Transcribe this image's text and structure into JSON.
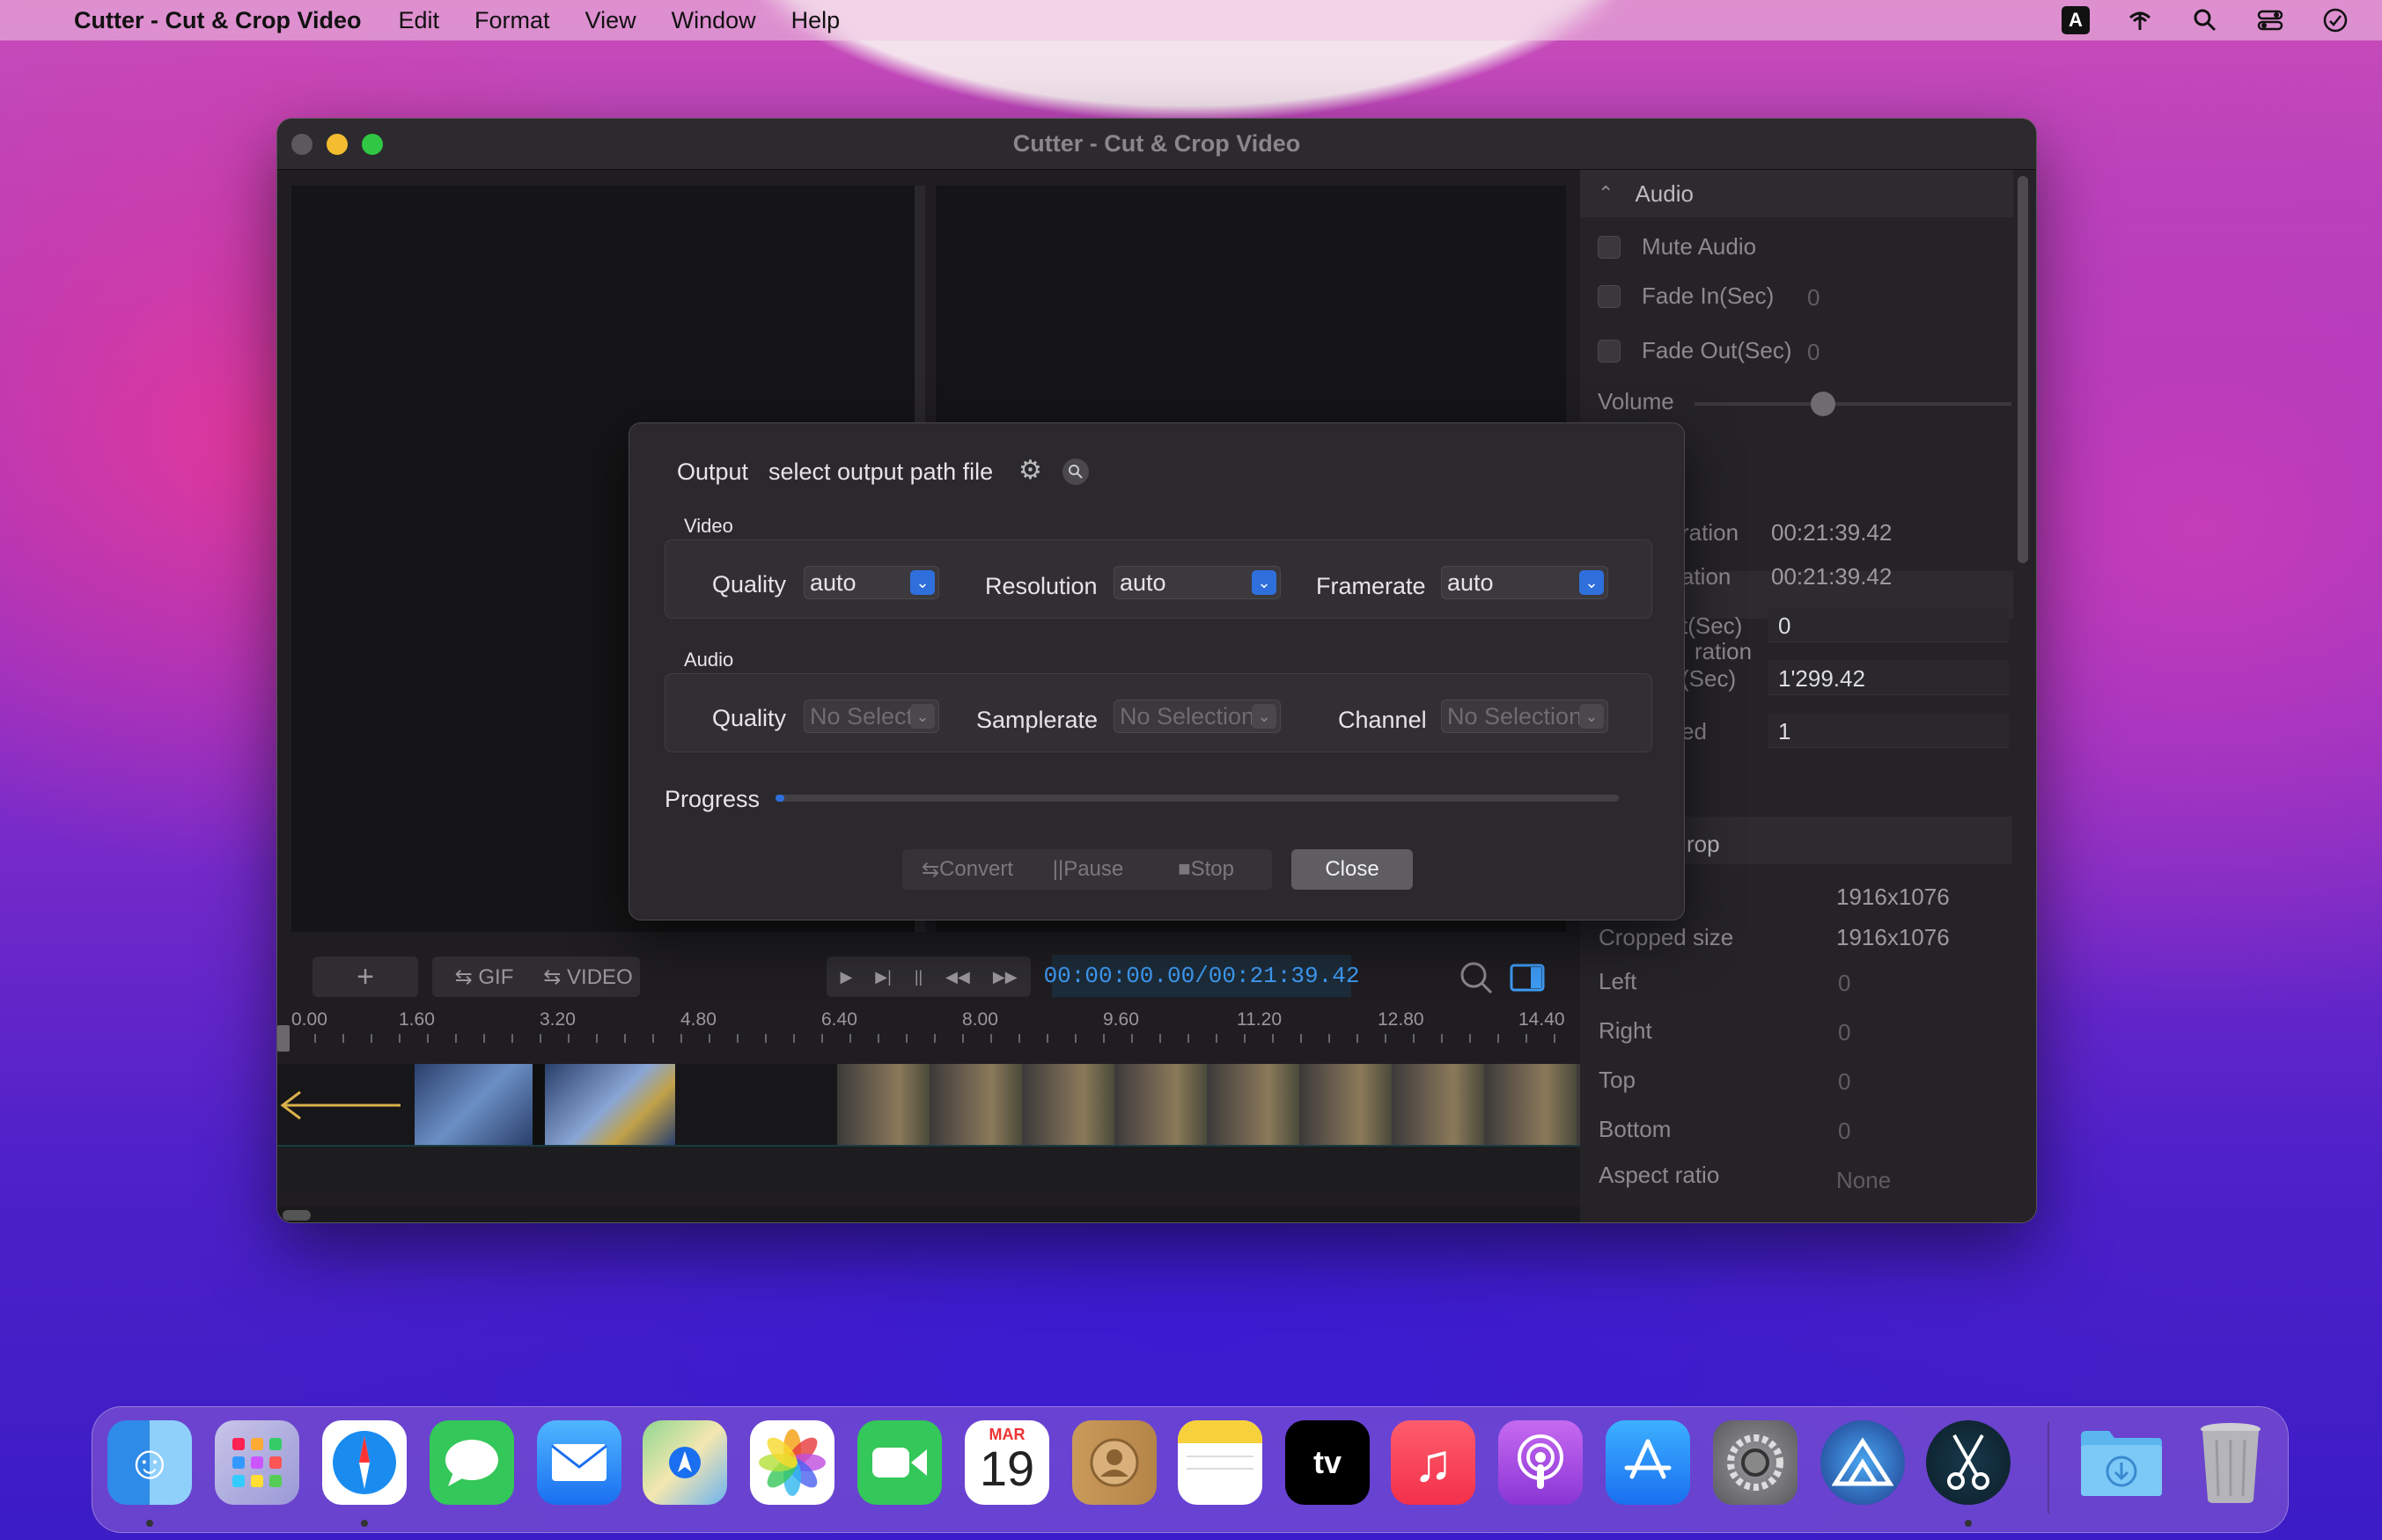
{
  "menubar": {
    "apple": "",
    "app_name": "Cutter - Cut & Crop Video",
    "items": [
      "Edit",
      "Format",
      "View",
      "Window",
      "Help"
    ],
    "keyboard_indicator": "A"
  },
  "window": {
    "title": "Cutter - Cut & Crop Video"
  },
  "toolbar": {
    "add": "+",
    "gif": "GIF",
    "video": "VIDEO",
    "timecode": "00:00:00.00/00:21:39.42"
  },
  "ruler": {
    "labels": [
      "0.00",
      "1.60",
      "3.20",
      "4.80",
      "6.40",
      "8.00",
      "9.60",
      "11.20",
      "12.80",
      "14.40"
    ]
  },
  "right_panel": {
    "audio_header": "Audio",
    "mute_audio": "Mute Audio",
    "fade_in": "Fade In(Sec)",
    "fade_in_value": "0",
    "fade_out": "Fade Out(Sec)",
    "fade_out_value": "0",
    "volume": "Volume",
    "volume_level": 0.4,
    "duration_label": "ration",
    "duration_value": "00:21:39.42",
    "duration2_label": "ation",
    "duration2_value": "00:21:39.42",
    "start_label": "t(Sec)",
    "start_value": "0",
    "end_label": "(Sec)",
    "end_value": "1'299.42",
    "speed_label": "ed",
    "speed_value": "1",
    "crop_header": "rop",
    "size_value": "1916x1076",
    "cropped_size_label": "Cropped size",
    "cropped_size_value": "1916x1076",
    "left": "Left",
    "left_value": "0",
    "right": "Right",
    "right_value": "0",
    "top": "Top",
    "top_value": "0",
    "bottom": "Bottom",
    "bottom_value": "0",
    "aspect_ratio": "Aspect ratio",
    "aspect_ratio_value": "None"
  },
  "dialog": {
    "output_label": "Output",
    "output_path": "select output path file",
    "video_section": "Video",
    "video_quality_label": "Quality",
    "video_quality": "auto",
    "resolution_label": "Resolution",
    "resolution": "auto",
    "framerate_label": "Framerate",
    "framerate": "auto",
    "audio_section": "Audio",
    "audio_quality_label": "Quality",
    "audio_quality": "No Select",
    "samplerate_label": "Samplerate",
    "samplerate": "No Selection",
    "channel_label": "Channel",
    "channel": "No Selection",
    "progress_label": "Progress",
    "progress": 0.0,
    "convert": "Convert",
    "pause": "Pause",
    "stop": "Stop",
    "close": "Close"
  },
  "dock": {
    "calendar_month": "MAR",
    "calendar_day": "19",
    "tv_label": "tv"
  },
  "colors": {
    "accent": "#2f6fdc",
    "timecode": "#3e9bf4"
  }
}
